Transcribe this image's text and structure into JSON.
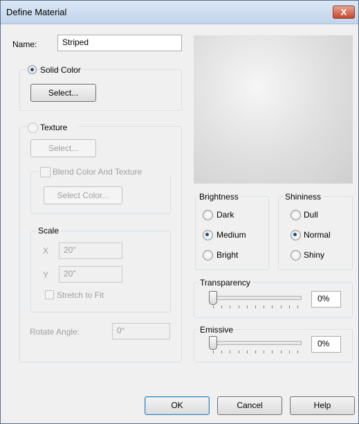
{
  "window": {
    "title": "Define Material",
    "close_symbol": "X"
  },
  "name_field": {
    "label": "Name:",
    "value": "Striped"
  },
  "solid_color": {
    "label": "Solid Color",
    "selected": true,
    "select_button": "Select..."
  },
  "texture": {
    "label": "Texture",
    "selected": false,
    "select_button": "Select...",
    "blend": {
      "label": "Blend Color And Texture",
      "checked": false,
      "select_color_button": "Select Color..."
    },
    "scale": {
      "label": "Scale",
      "x_label": "X",
      "x_value": "20\"",
      "y_label": "Y",
      "y_value": "20\"",
      "stretch_label": "Stretch to Fit"
    },
    "rotate": {
      "label": "Rotate Angle:",
      "value": "0°"
    }
  },
  "brightness": {
    "label": "Brightness",
    "options": [
      "Dark",
      "Medium",
      "Bright"
    ],
    "selected": "Medium"
  },
  "shininess": {
    "label": "Shininess",
    "options": [
      "Dull",
      "Normal",
      "Shiny"
    ],
    "selected": "Normal"
  },
  "transparency": {
    "label": "Transparency",
    "value": "0%",
    "level": 0
  },
  "emissive": {
    "label": "Emissive",
    "value": "0%",
    "level": 0
  },
  "buttons": {
    "ok": "OK",
    "cancel": "Cancel",
    "help": "Help"
  },
  "colors": {
    "title_bar": "#c8d9ee",
    "close_button": "#c7462b",
    "dialog_bg": "#f0f0f0",
    "radio_dot": "#1c5180"
  },
  "icons": {
    "close": "close-icon"
  }
}
